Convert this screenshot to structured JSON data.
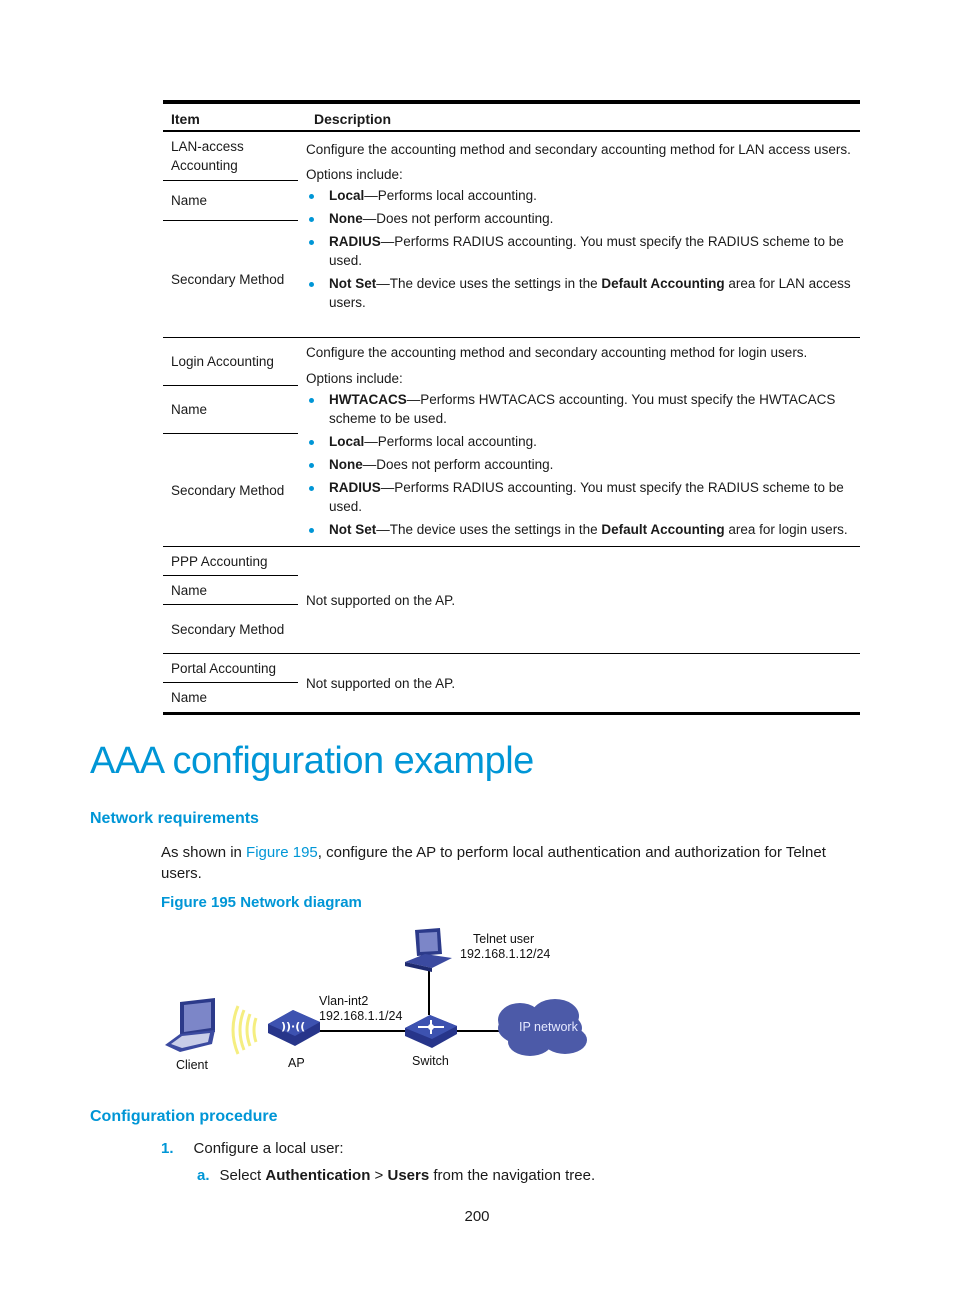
{
  "table": {
    "headers": [
      "Item",
      "Description"
    ],
    "groups": [
      {
        "items": [
          "LAN-access Accounting",
          "Name",
          "Secondary Method"
        ],
        "intro": "Configure the accounting method and secondary accounting method for LAN access users.",
        "options_label": "Options include:",
        "options": [
          {
            "term": "Local",
            "text": "—Performs local accounting."
          },
          {
            "term": "None",
            "text": "—Does not perform accounting."
          },
          {
            "term": "RADIUS",
            "text": "—Performs RADIUS accounting. You must specify the RADIUS scheme to be used."
          },
          {
            "term": "Not Set",
            "text_before": "—The device uses the settings in the ",
            "bold_mid": "Default Accounting",
            "text_after": " area for LAN access users."
          }
        ]
      },
      {
        "items": [
          "Login Accounting",
          "Name",
          "Secondary Method"
        ],
        "intro": "Configure the accounting method and secondary accounting method for login users.",
        "options_label": "Options include:",
        "options": [
          {
            "term": "HWTACACS",
            "text": "—Performs HWTACACS accounting. You must specify the HWTACACS scheme to be used."
          },
          {
            "term": "Local",
            "text": "—Performs local accounting."
          },
          {
            "term": "None",
            "text": "—Does not perform accounting."
          },
          {
            "term": "RADIUS",
            "text": "—Performs RADIUS accounting. You must specify the RADIUS scheme to be used."
          },
          {
            "term": "Not Set",
            "text_before": "—The device uses the settings in the ",
            "bold_mid": "Default Accounting",
            "text_after": " area for login users."
          }
        ]
      },
      {
        "items": [
          "PPP Accounting",
          "Name",
          "Secondary Method"
        ],
        "description": "Not supported on the AP."
      },
      {
        "items": [
          "Portal Accounting",
          "Name"
        ],
        "description": "Not supported on the AP."
      }
    ]
  },
  "section_title": "AAA configuration example",
  "network_requirements": {
    "heading": "Network requirements",
    "text_before": "As shown in ",
    "link": "Figure 195",
    "text_after": ", configure the AP to perform local authentication and authorization for Telnet users."
  },
  "figure": {
    "caption": "Figure 195 Network diagram",
    "labels": {
      "client": "Client",
      "ap": "AP",
      "switch": "Switch",
      "switch_badge": "SWITCH",
      "telnet_user": "Telnet user",
      "telnet_ip": "192.168.1.12/24",
      "vlan": "Vlan-int2",
      "vlan_ip": "192.168.1.1/24",
      "ip_network": "IP network"
    }
  },
  "configuration_procedure": {
    "heading": "Configuration procedure",
    "steps": [
      {
        "num": "1.",
        "text": "Configure a local user:"
      }
    ],
    "substeps": [
      {
        "num": "a.",
        "text_before": "Select ",
        "bold1": "Authentication",
        "sep": " > ",
        "bold2": "Users",
        "text_after": " from the navigation tree."
      }
    ]
  },
  "page_number": "200"
}
